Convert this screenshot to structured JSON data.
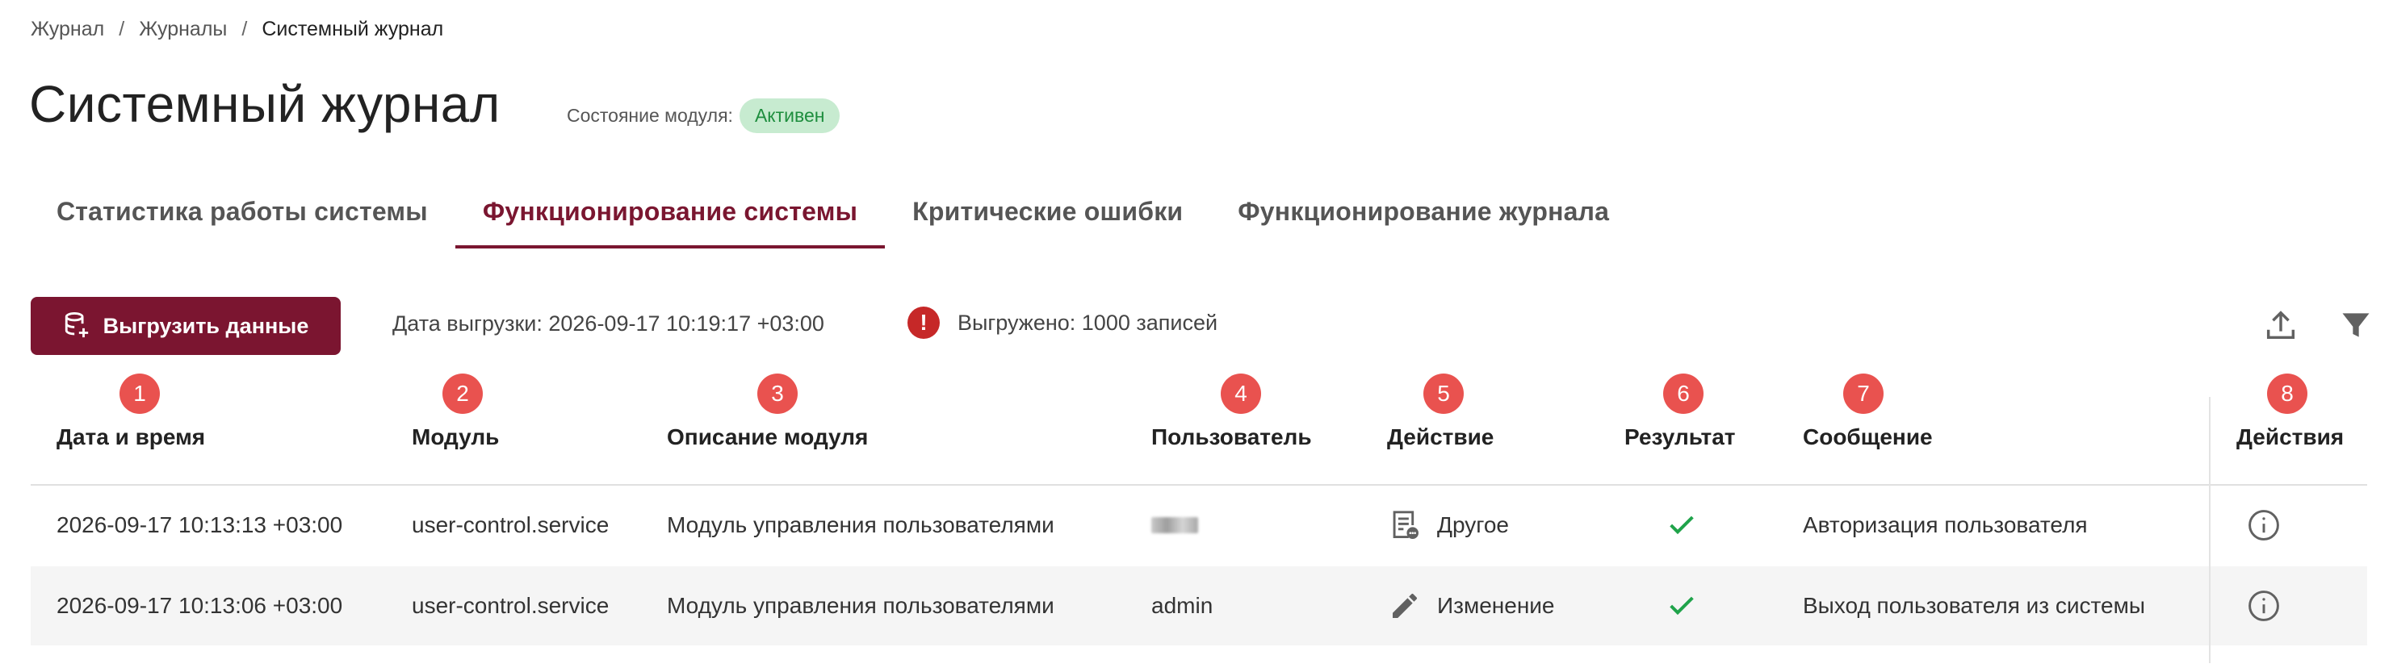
{
  "breadcrumb": [
    "Журнал",
    "Журналы",
    "Системный журнал"
  ],
  "breadcrumb_separator": "/",
  "page": {
    "title": "Системный журнал",
    "module_state_label": "Состояние модуля:",
    "module_state_value": "Активен",
    "module_state_color": "#1e8e3e"
  },
  "tabs": [
    {
      "label": "Статистика работы системы",
      "active": false
    },
    {
      "label": "Функционирование системы",
      "active": true
    },
    {
      "label": "Критические ошибки",
      "active": false
    },
    {
      "label": "Функционирование журнала",
      "active": false
    }
  ],
  "toolbar": {
    "export_button_label": "Выгрузить данные",
    "export_icon": "database-export-icon",
    "export_date": "Дата выгрузки: 2026-09-17 10:19:17 +03:00",
    "export_count": "Выгружено: 1000 записей",
    "warning_icon": "error-icon",
    "warning_glyph": "!",
    "upload_icon": "upload-icon",
    "filter_icon": "filter-icon"
  },
  "markers": [
    "1",
    "2",
    "3",
    "4",
    "5",
    "6",
    "7",
    "8"
  ],
  "table": {
    "columns": [
      "Дата и время",
      "Модуль",
      "Описание модуля",
      "Пользователь",
      "Действие",
      "Результат",
      "Сообщение",
      "Действия"
    ],
    "rows": [
      {
        "datetime": "2026-09-17 10:13:13 +03:00",
        "module": "user-control.service",
        "description": "Модуль управления пользователями",
        "user": "",
        "user_blurred": true,
        "action": "Другое",
        "action_icon": "document-other-icon",
        "result_icon": "check-icon",
        "message": "Авторизация пользователя",
        "row_action_icon": "info-icon"
      },
      {
        "datetime": "2026-09-17 10:13:06 +03:00",
        "module": "user-control.service",
        "description": "Модуль управления пользователями",
        "user": "admin",
        "user_blurred": false,
        "action": "Изменение",
        "action_icon": "pencil-icon",
        "result_icon": "check-icon",
        "message": "Выход пользователя из системы",
        "row_action_icon": "info-icon"
      }
    ]
  },
  "colors": {
    "primary": "#7b1530",
    "tab_active": "#7a1630",
    "marker": "#e9524f",
    "success": "#1fa34a",
    "error": "#c62828",
    "badge_bg": "#c7ebd0"
  }
}
